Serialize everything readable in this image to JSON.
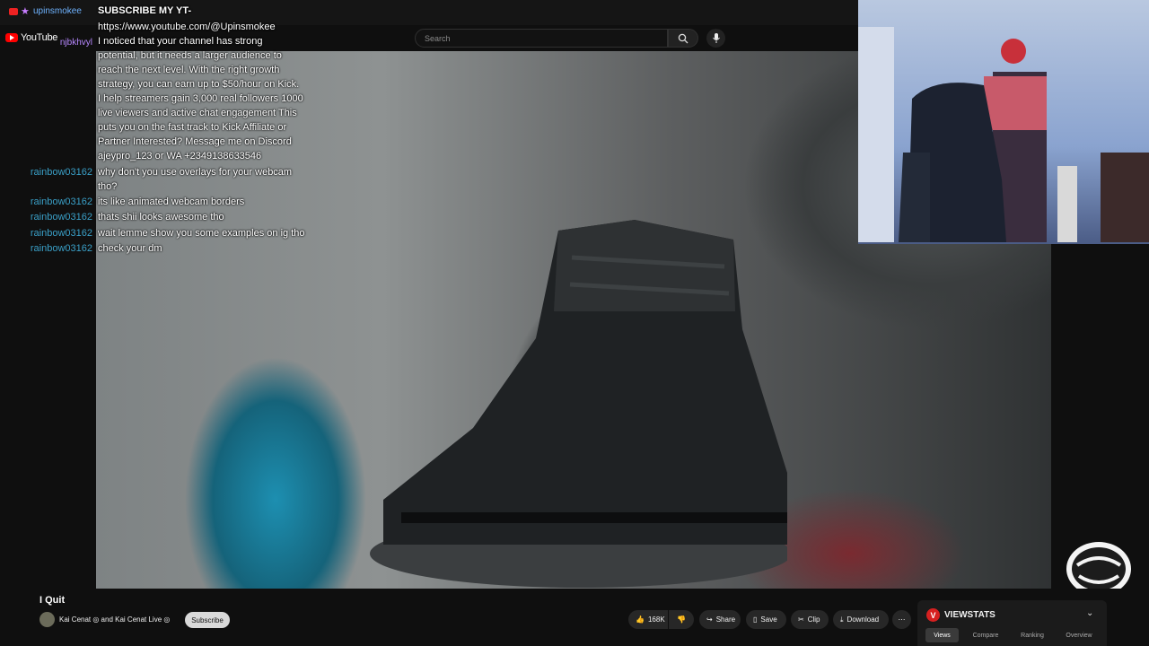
{
  "stream_banner": {
    "text": "SUBSCRIBE MY YT-"
  },
  "youtube": {
    "logo_text": "YouTube",
    "search_placeholder": "Search"
  },
  "chat": [
    {
      "user": "njbkhvyl",
      "text": "https://www.youtube.com/@Upinsmokee"
    },
    {
      "user": "",
      "text": "I noticed that your channel has strong potential, but it needs a larger audience to reach the next level. With the right growth strategy, you can earn up to $50/hour on Kick. I help streamers gain 3,000 real followers 1000 live viewers and active chat engagement This puts you on the fast track to Kick Affiliate or Partner Interested? Message me on Discord ajeypro_123 or WA +2349138633546"
    },
    {
      "user": "rainbow03162",
      "text": "why don't you use overlays for your webcam tho?"
    },
    {
      "user": "rainbow03162",
      "text": "its like animated webcam borders"
    },
    {
      "user": "rainbow03162",
      "text": "thats shii looks awesome tho"
    },
    {
      "user": "rainbow03162",
      "text": "wait lemme show you some examples on ig tho"
    },
    {
      "user": "rainbow03162",
      "text": "check your dm"
    }
  ],
  "stream_user": "upinsmokee",
  "video": {
    "title": "I Quit",
    "channel": "Kai Cenat ◎ and Kai Cenat Live ◎",
    "subscribe_label": "Subscribe",
    "like_count": "168K",
    "share_label": "Share",
    "save_label": "Save",
    "clip_label": "Clip",
    "download_label": "Download"
  },
  "viewstats": {
    "title": "VIEWSTATS",
    "tabs": [
      "Views",
      "Compare",
      "Ranking",
      "Overview"
    ],
    "active_tab": "Views"
  },
  "colors": {
    "accent": "#ff0000",
    "chat_user": "#3aa0c8",
    "viewstats_red": "#d62020"
  }
}
